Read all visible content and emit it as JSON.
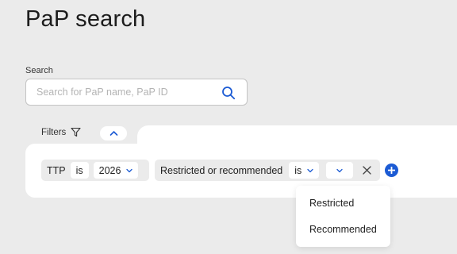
{
  "page": {
    "title": "PaP search"
  },
  "search": {
    "label": "Search",
    "placeholder": "Search for PaP name, PaP ID",
    "value": ""
  },
  "filters": {
    "label": "Filters",
    "rows": [
      {
        "field": "TTP",
        "operator": "is",
        "value": "2026"
      },
      {
        "field": "Restricted or recommended",
        "operator": "is",
        "value": ""
      }
    ]
  },
  "dropdown": {
    "options": [
      "Restricted",
      "Recommended"
    ]
  },
  "colors": {
    "background": "#ebebeb",
    "panel": "#ffffff",
    "accent": "#1c5bd4"
  },
  "icons": {
    "search": "search-icon",
    "filter": "funnel-icon",
    "collapse": "chevron-up-icon",
    "chevron": "chevron-down-icon",
    "remove": "close-icon",
    "add": "plus-circle-icon"
  }
}
